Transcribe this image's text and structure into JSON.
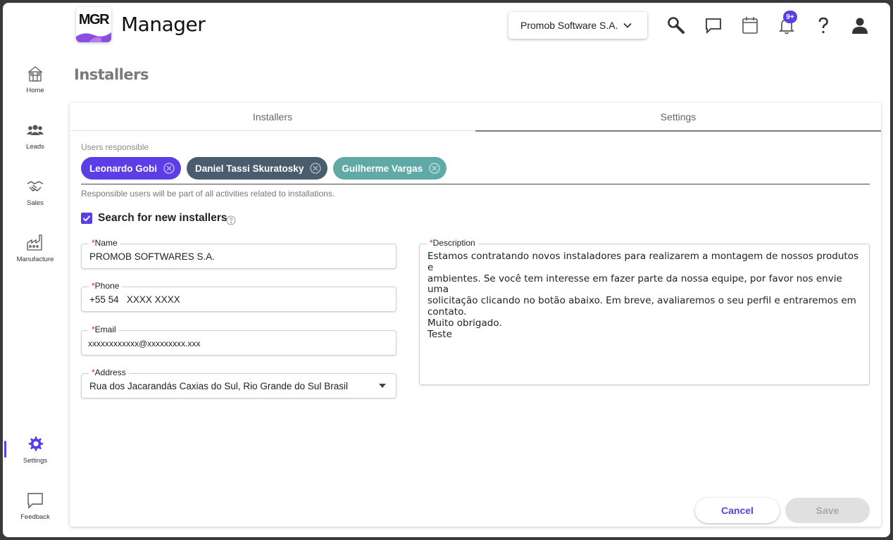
{
  "app": {
    "logo_text": "MGR",
    "title": "Manager"
  },
  "header": {
    "company": "Promob Software S.A.",
    "notification_badge": "9+",
    "icons": [
      "search-icon",
      "chat-icon",
      "calendar-icon",
      "bell-icon",
      "help-icon",
      "user-icon"
    ]
  },
  "sidebar": {
    "items": [
      {
        "label": "Home",
        "icon": "home-icon"
      },
      {
        "label": "Leads",
        "icon": "people-icon"
      },
      {
        "label": "Sales",
        "icon": "handshake-icon"
      },
      {
        "label": "Manufacture",
        "icon": "factory-icon"
      },
      {
        "label": "Settings",
        "icon": "gear-icon",
        "active": true
      },
      {
        "label": "Feedback",
        "icon": "feedback-icon"
      }
    ]
  },
  "page": {
    "title": "Installers"
  },
  "tabs": [
    {
      "label": "Installers",
      "active": false
    },
    {
      "label": "Settings",
      "active": true
    }
  ],
  "form": {
    "users_label": "Users responsible",
    "users": [
      {
        "name": "Leonardo Gobi",
        "color": "#5b3ee6"
      },
      {
        "name": "Daniel Tassi Skuratosky",
        "color": "#4a5d6e"
      },
      {
        "name": "Guilherme Vargas",
        "color": "#5fa9a6"
      }
    ],
    "users_hint": "Responsible users will be part of all activities related to installations.",
    "search_checkbox_label": "Search for new installers",
    "search_checked": true,
    "required_mark": "*",
    "name_label": "Name",
    "name_value": "PROMOB SOFTWARES S.A.",
    "phone_label": "Phone",
    "phone_value": "+55 54   XXXX XXXX",
    "email_label": "Email",
    "email_value": "xxxxxxxxxxxx@xxxxxxxxx.xxx",
    "address_label": "Address",
    "address_value": "Rua dos Jacarandás Caxias do Sul, Rio Grande do Sul Brasil",
    "description_label": "Description",
    "description_value": "Estamos contratando novos instaladores para realizarem a montagem de nossos produtos e\nambientes. Se você tem interesse em fazer parte da nossa equipe, por favor nos envie uma\nsolicitação clicando no botão abaixo. Em breve, avaliaremos o seu perfil e entraremos em contato.\nMuito obrigado.\nTeste"
  },
  "buttons": {
    "cancel": "Cancel",
    "save": "Save"
  },
  "colors": {
    "accent": "#5b3ee6",
    "disabled_bg": "#e0e0e0"
  }
}
